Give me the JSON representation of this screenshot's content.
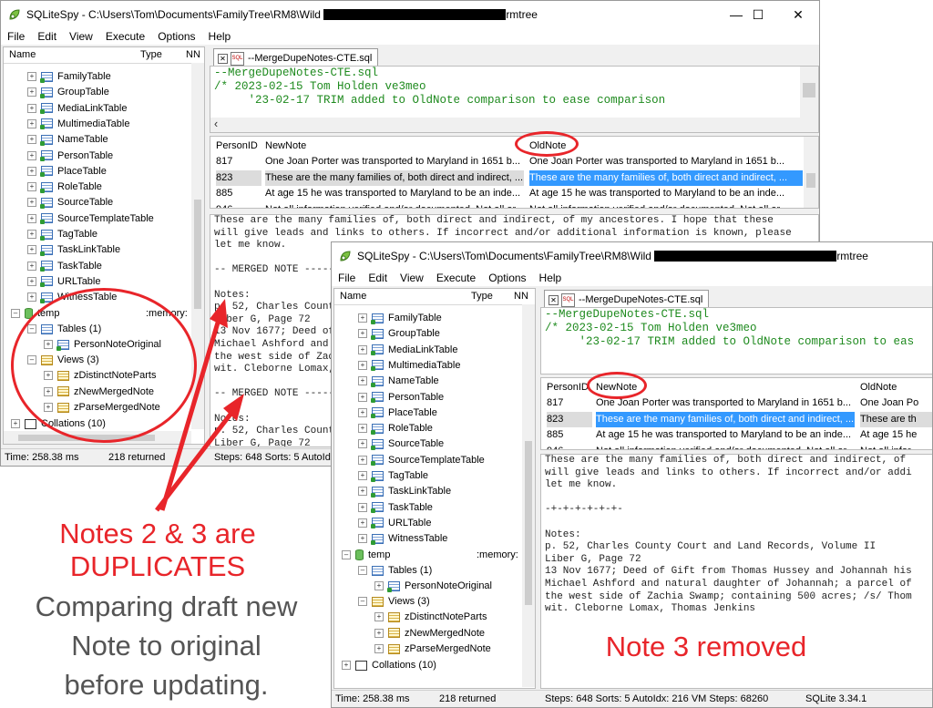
{
  "colors": {
    "annotation": "#e8252a",
    "comment_text": "#1e8a1e",
    "selection": "#3399ff"
  },
  "annotation": {
    "duplicates_line1": "Notes 2 & 3 are",
    "duplicates_line2": "DUPLICATES",
    "compare_line1": "Comparing draft new",
    "compare_line2": "Note to original",
    "compare_line3": "before updating.",
    "removed": "Note 3 removed"
  },
  "window1": {
    "title_prefix": "SQLiteSpy - C:\\Users\\Tom\\Documents\\FamilyTree\\RM8\\Wild",
    "title_suffix": "rmtree",
    "menu": [
      "File",
      "Edit",
      "View",
      "Execute",
      "Options",
      "Help"
    ],
    "tree_headers": {
      "name": "Name",
      "type": "Type",
      "nn": "NN"
    },
    "tables": [
      "FamilyTable",
      "GroupTable",
      "MediaLinkTable",
      "MultimediaTable",
      "NameTable",
      "PersonTable",
      "PlaceTable",
      "RoleTable",
      "SourceTable",
      "SourceTemplateTable",
      "TagTable",
      "TaskLinkTable",
      "TaskTable",
      "URLTable",
      "WitnessTable"
    ],
    "temp_label": "temp",
    "temp_type": ":memory:",
    "tables_group": "Tables (1)",
    "temp_table": "PersonNoteOriginal",
    "views_group": "Views (3)",
    "views": [
      "zDistinctNoteParts",
      "zNewMergedNote",
      "zParseMergedNote"
    ],
    "collations": "Collations (10)",
    "tab_label": "--MergeDupeNotes-CTE.sql",
    "sql_lines": [
      "--MergeDupeNotes-CTE.sql",
      "/* 2023-02-15 Tom Holden ve3meo",
      "     '23-02-17 TRIM added to OldNote comparison to ease comparison"
    ],
    "grid_headers": [
      "PersonID",
      "NewNote",
      "OldNote"
    ],
    "grid_rows": [
      {
        "id": "817",
        "new": "One Joan Porter was transported to Maryland in 1651 b...",
        "old": "One Joan Porter was transported to Maryland in 1651 b..."
      },
      {
        "id": "823",
        "new": "These are the many families of, both direct and indirect, ...",
        "old": "These are the many families of, both direct and indirect, ..."
      },
      {
        "id": "885",
        "new": "At age 15 he was transported to Maryland to be an inde...",
        "old": "At age 15 he was transported to Maryland to be an inde..."
      },
      {
        "id": "946",
        "new": "Not all information verified and/or documented. Not all ar...",
        "old": "Not all information verified and/or documented. Not all ar..."
      }
    ],
    "note_lines": [
      "These are the many families of, both direct and indirect, of my ancestores. I hope that these",
      "will give leads and links to others. If incorrect and/or additional information is known, please",
      "let me know.",
      "",
      "-- MERGED NOTE -----",
      "",
      "Notes:",
      "p. 52, Charles Count",
      "Liber G, Page 72",
      "13 Nov 1677; Deed of",
      "Michael Ashford and",
      "the west side of Zac",
      "wit. Cleborne Lomax,",
      "",
      "-- MERGED NOTE -----",
      "",
      "Notes:",
      "p. 52, Charles Count",
      "Liber G, Page 72"
    ],
    "status": {
      "time": "Time: 258.38 ms",
      "returned": "218 returned",
      "steps": "Steps: 648  Sorts: 5  AutoId"
    }
  },
  "window2": {
    "title_prefix": "SQLiteSpy - C:\\Users\\Tom\\Documents\\FamilyTree\\RM8\\Wild",
    "title_suffix": "rmtree",
    "menu": [
      "File",
      "Edit",
      "View",
      "Execute",
      "Options",
      "Help"
    ],
    "tree_headers": {
      "name": "Name",
      "type": "Type",
      "nn": "NN"
    },
    "tables": [
      "FamilyTable",
      "GroupTable",
      "MediaLinkTable",
      "MultimediaTable",
      "NameTable",
      "PersonTable",
      "PlaceTable",
      "RoleTable",
      "SourceTable",
      "SourceTemplateTable",
      "TagTable",
      "TaskLinkTable",
      "TaskTable",
      "URLTable",
      "WitnessTable"
    ],
    "temp_label": "temp",
    "temp_type": ":memory:",
    "tables_group": "Tables (1)",
    "temp_table": "PersonNoteOriginal",
    "views_group": "Views (3)",
    "views": [
      "zDistinctNoteParts",
      "zNewMergedNote",
      "zParseMergedNote"
    ],
    "collations": "Collations (10)",
    "tab_label": "--MergeDupeNotes-CTE.sql",
    "sql_lines": [
      "--MergeDupeNotes-CTE.sql",
      "/* 2023-02-15 Tom Holden ve3meo",
      "     '23-02-17 TRIM added to OldNote comparison to eas"
    ],
    "grid_headers": [
      "PersonID",
      "NewNote",
      "OldNote"
    ],
    "grid_rows": [
      {
        "id": "817",
        "new": "One Joan Porter was transported to Maryland in 1651 b...",
        "old": "One Joan Po"
      },
      {
        "id": "823",
        "new": "These are the many families of, both direct and indirect, ...",
        "old": "These are th"
      },
      {
        "id": "885",
        "new": "At age 15 he was transported to Maryland to be an inde...",
        "old": "At age 15 he"
      },
      {
        "id": "946",
        "new": "Not all information verified and/or documented. Not all ar...",
        "old": "Not all infor"
      }
    ],
    "note_lines": [
      "These are the many families of, both direct and indirect, of",
      "will give leads and links to others. If incorrect and/or addi",
      "let me know.",
      "",
      "-+-+-+-+-+-+-",
      "",
      "Notes:",
      "p. 52, Charles County Court and Land Records, Volume II",
      "Liber G, Page 72",
      "13 Nov 1677; Deed of Gift from Thomas Hussey and Johannah his",
      "Michael Ashford and natural daughter of Johannah; a parcel of",
      "the west side of Zachia Swamp; containing 500 acres; /s/ Thom",
      "wit. Cleborne Lomax, Thomas Jenkins"
    ],
    "status": {
      "time": "Time: 258.38 ms",
      "returned": "218 returned",
      "steps": "Steps: 648  Sorts: 5  AutoIdx: 216  VM Steps: 68260",
      "version": "SQLite 3.34.1"
    }
  }
}
